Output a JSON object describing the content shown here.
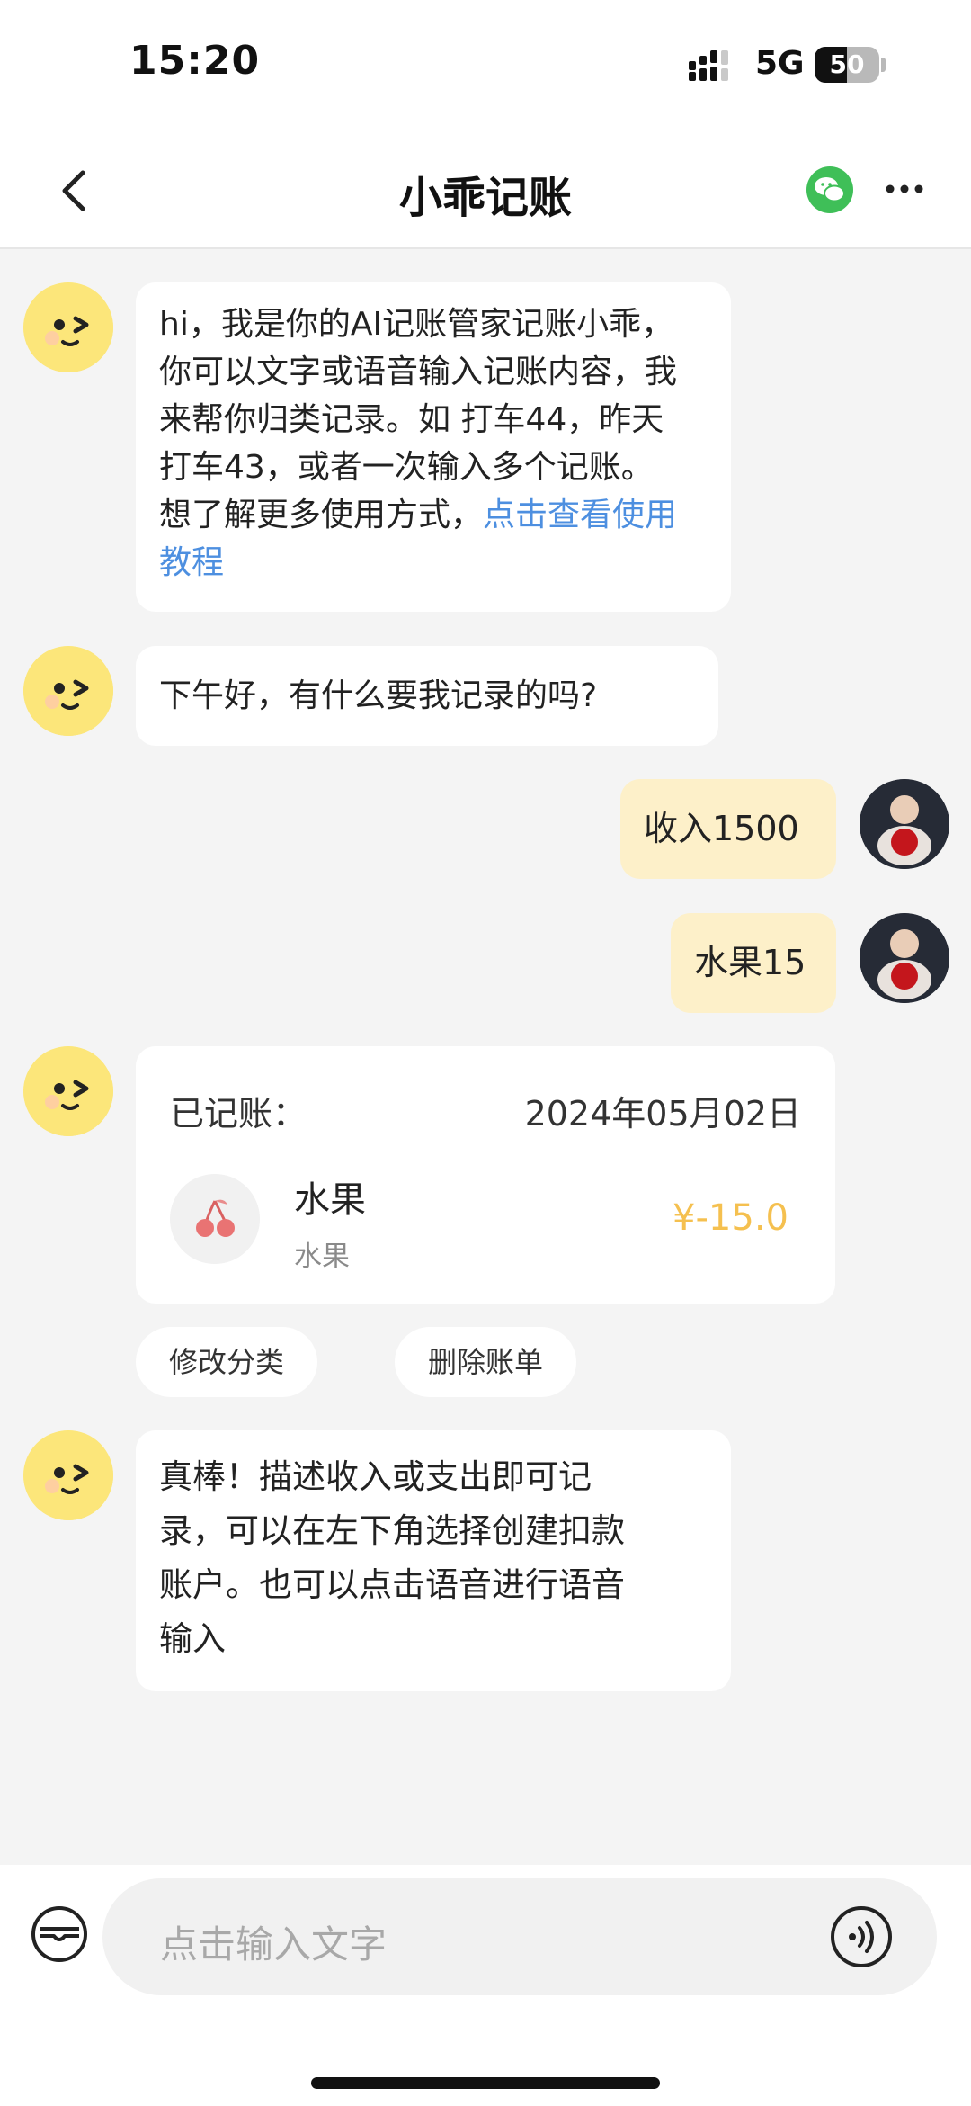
{
  "status_bar": {
    "time": "15:20",
    "network": "5G",
    "battery": "50",
    "battery_fraction": 0.5
  },
  "header": {
    "title": "小乖记账"
  },
  "messages": {
    "intro": {
      "line1": "hi，我是你的AI记账管家记账小乖，",
      "line2": "你可以文字或语音输入记账内容，我",
      "line3": "来帮你归类记录。如 打车44，昨天",
      "line4": "打车43，或者一次输入多个记账。",
      "line5_prefix": "想了解更多使用方式，",
      "link_a": "点击查看使用",
      "link_b": "教程"
    },
    "greeting": "下午好，有什么要我记录的吗?",
    "user1": "收入1500",
    "user2": "水果15",
    "tips": {
      "line1": "真棒！描述收入或支出即可记",
      "line2": "录，可以在左下角选择创建扣款",
      "line3": "账户。也可以点击语音进行语音",
      "line4": "输入"
    }
  },
  "record_card": {
    "label": "已记账：",
    "date": "2024年05月02日",
    "item_title": "水果",
    "item_category": "水果",
    "amount": "¥-15.0",
    "icon": "cherry-icon"
  },
  "actions": {
    "edit_category": "修改分类",
    "delete_bill": "删除账单"
  },
  "input_bar": {
    "placeholder": "点击输入文字"
  },
  "colors": {
    "accent_link": "#4d8fe0",
    "user_bubble": "#fdf0c9",
    "amount": "#f5c04f",
    "wechat_green": "#3fbf58"
  }
}
